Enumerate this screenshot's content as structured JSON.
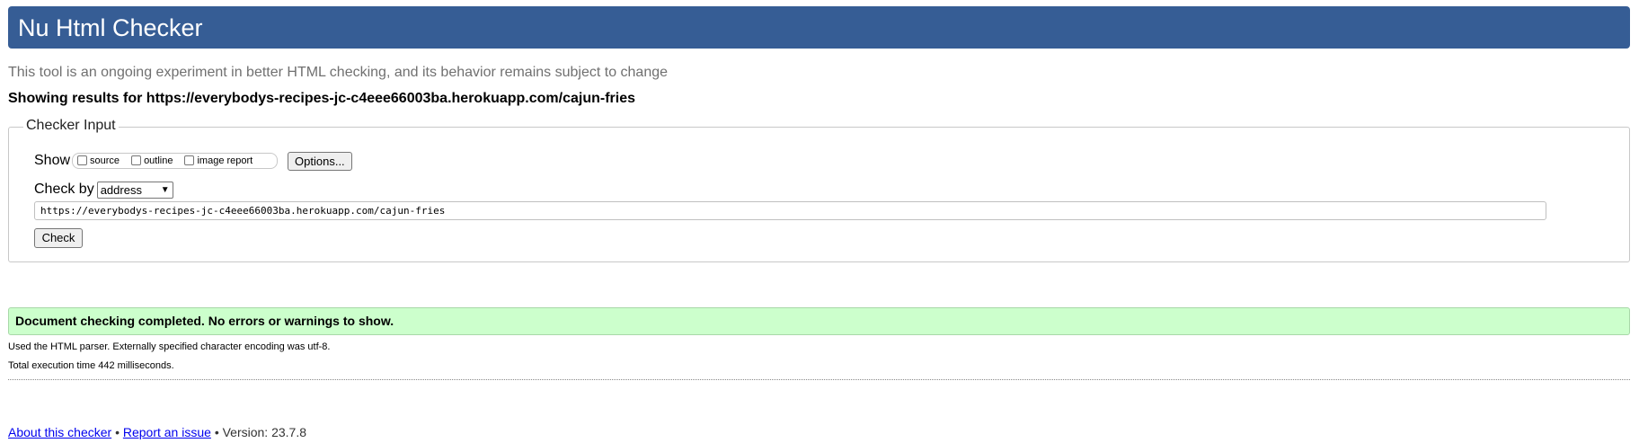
{
  "header": {
    "title": "Nu Html Checker"
  },
  "tagline": "This tool is an ongoing experiment in better HTML checking, and its behavior remains subject to change",
  "results_for": "Showing results for https://everybodys-recipes-jc-c4eee66003ba.herokuapp.com/cajun-fries",
  "checker_input": {
    "legend": "Checker Input",
    "show_label": "Show",
    "checkboxes": [
      {
        "label": "source",
        "checked": false
      },
      {
        "label": "outline",
        "checked": false
      },
      {
        "label": "image report",
        "checked": false
      }
    ],
    "options_button": "Options...",
    "check_by_label": "Check by",
    "check_by_selected": "address",
    "url_value": "https://everybodys-recipes-jc-c4eee66003ba.herokuapp.com/cajun-fries",
    "check_button": "Check"
  },
  "status": {
    "message": "Document checking completed. No errors or warnings to show.",
    "color": "#ccffcc"
  },
  "details": {
    "parser": "Used the HTML parser. Externally specified character encoding was utf-8.",
    "execution": "Total execution time 442 milliseconds."
  },
  "footer": {
    "about_link": "About this checker",
    "separator": "•",
    "report_link": "Report an issue",
    "version": "Version: 23.7.8"
  },
  "colors": {
    "header_bg": "#365d95",
    "link": "#0000ee"
  }
}
